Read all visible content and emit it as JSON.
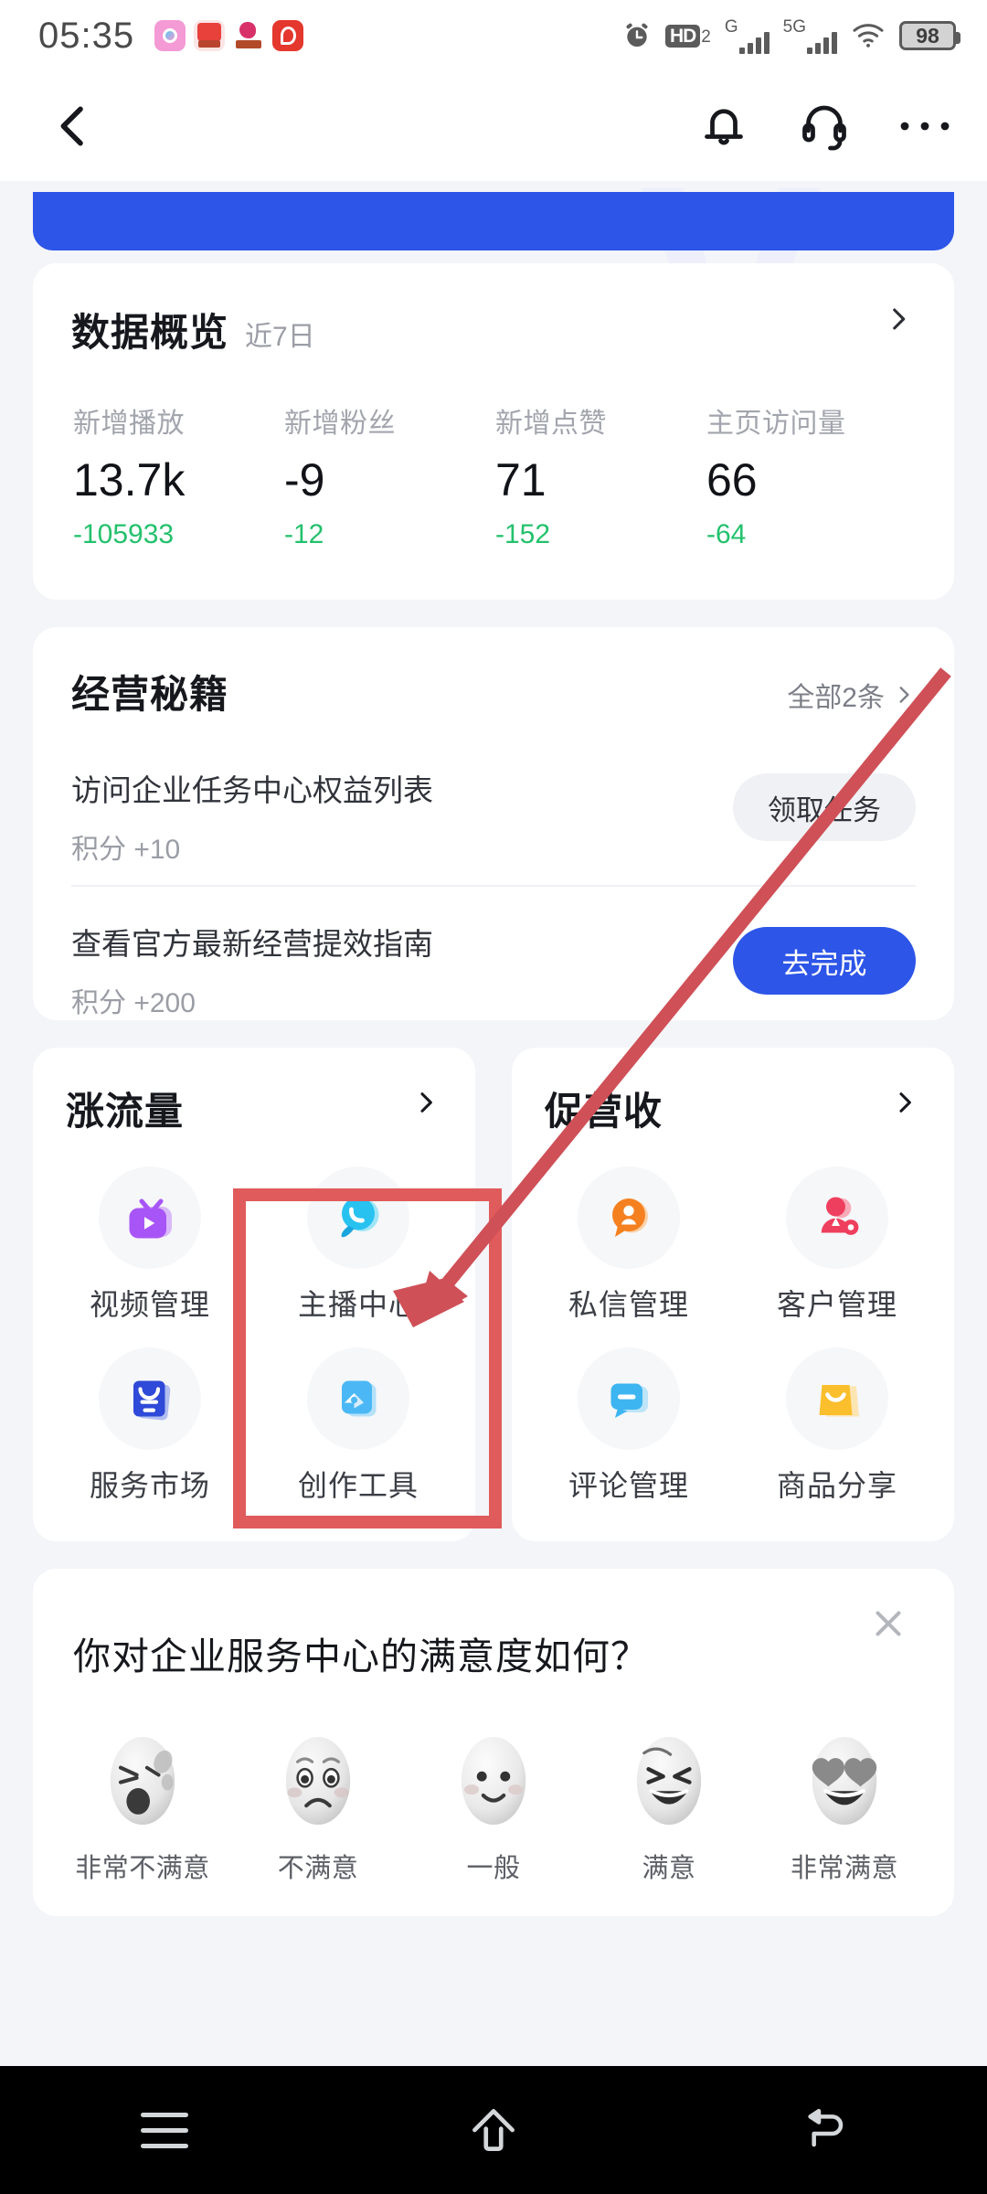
{
  "status_bar": {
    "time": "05:35",
    "app_icons": [
      "app-icon-pink",
      "app-icon-xiaohongshu",
      "app-icon-bird",
      "app-icon-netease-music"
    ],
    "alarm_icon": "alarm-clock-icon",
    "hd_label": "HD",
    "hd_sub": "2",
    "signal1_label": "G",
    "signal2_label": "5G",
    "wifi_icon": "wifi-icon",
    "battery_level": "98"
  },
  "nav": {
    "back_icon": "back-chevron-icon",
    "bell_icon": "bell-icon",
    "headset_icon": "headset-icon",
    "more_icon": "more-dots-icon"
  },
  "watermark": "V",
  "overview": {
    "title": "数据概览",
    "range": "近7日",
    "chevron": "chevron-right-icon",
    "metrics": [
      {
        "label": "新增播放",
        "value": "13.7k",
        "delta": "-105933"
      },
      {
        "label": "新增粉丝",
        "value": "-9",
        "delta": "-12"
      },
      {
        "label": "新增点赞",
        "value": "71",
        "delta": "-152"
      },
      {
        "label": "主页访问量",
        "value": "66",
        "delta": "-64"
      }
    ],
    "delta_color": "#23c16c"
  },
  "tips": {
    "title": "经营秘籍",
    "all_label": "全部2条",
    "chevron": "chevron-right-icon",
    "rows": [
      {
        "text": "访问企业任务中心权益列表",
        "score": "积分 +10",
        "button": "领取任务",
        "style": "ghost"
      },
      {
        "text": "查看官方最新经营提效指南",
        "score": "积分 +200",
        "button": "去完成",
        "style": "primary"
      }
    ],
    "primary_color": "#2d55e8"
  },
  "grid_cards": [
    {
      "title": "涨流量",
      "chevron": "chevron-right-icon",
      "items": [
        {
          "label": "视频管理",
          "icon": "tv-play-icon",
          "color": "#a855f7"
        },
        {
          "label": "主播中心",
          "icon": "speech-bubble-icon",
          "color": "#27c2f0"
        },
        {
          "label": "服务市场",
          "icon": "shop-bag-icon",
          "color": "#2f49d8"
        },
        {
          "label": "创作工具",
          "icon": "video-clip-icon",
          "color": "#4bb8f5"
        }
      ]
    },
    {
      "title": "促营收",
      "chevron": "chevron-right-icon",
      "items": [
        {
          "label": "私信管理",
          "icon": "person-bubble-icon",
          "color": "#f58020"
        },
        {
          "label": "客户管理",
          "icon": "person-gear-icon",
          "color": "#ef3f5e"
        },
        {
          "label": "评论管理",
          "icon": "comment-icon",
          "color": "#3db5f0"
        },
        {
          "label": "商品分享",
          "icon": "shopping-bag-icon",
          "color": "#fbbe2c"
        }
      ]
    }
  ],
  "survey": {
    "question": "你对企业服务中心的满意度如何？",
    "close_icon": "close-x-icon",
    "options": [
      {
        "label": "非常不满意",
        "face": "face-angry-icon"
      },
      {
        "label": "不满意",
        "face": "face-sad-icon"
      },
      {
        "label": "一般",
        "face": "face-neutral-icon"
      },
      {
        "label": "满意",
        "face": "face-happy-icon"
      },
      {
        "label": "非常满意",
        "face": "face-heart-eyes-icon"
      }
    ]
  },
  "annotation": {
    "color": "#e05b5b",
    "box_target": "主播中心"
  },
  "android_nav": {
    "menu_icon": "menu-icon",
    "home_icon": "home-icon",
    "back_icon": "back-icon"
  }
}
